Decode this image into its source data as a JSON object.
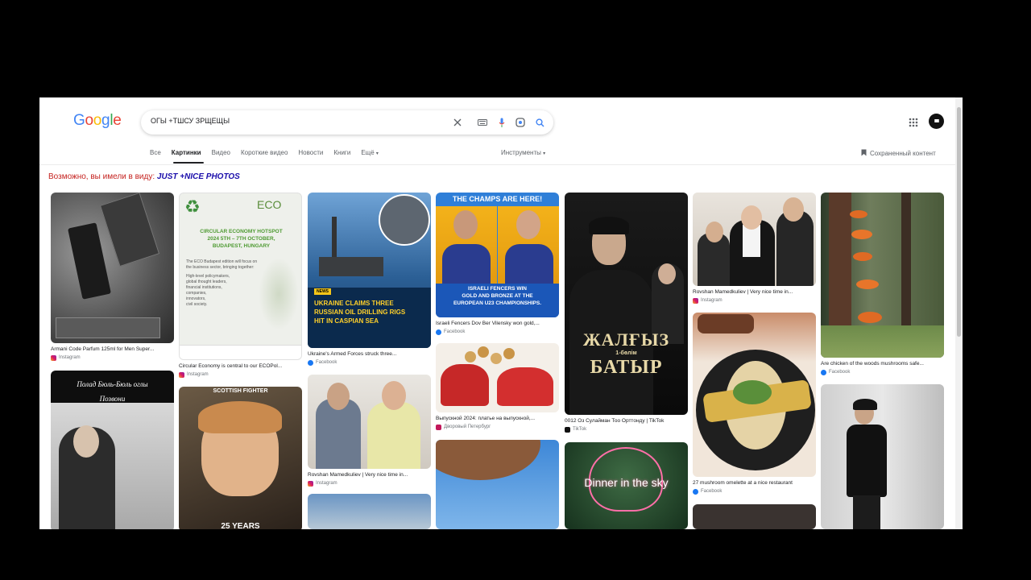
{
  "logo": {
    "g1": "G",
    "o1": "o",
    "o2": "o",
    "g2": "g",
    "l": "l",
    "e": "e"
  },
  "search": {
    "query": "ОГЫ +ТШСУ ЗРЩЕЩЫ"
  },
  "icons": {
    "clear": "close-icon",
    "keyboard": "keyboard-icon",
    "mic": "mic-icon",
    "lens": "lens-icon",
    "search": "search-icon",
    "apps": "apps-grid-icon",
    "saved": "bookmark-icon"
  },
  "tabs": [
    {
      "label": "Все"
    },
    {
      "label": "Картинки",
      "active": true
    },
    {
      "label": "Видео"
    },
    {
      "label": "Короткие видео"
    },
    {
      "label": "Новости"
    },
    {
      "label": "Книги"
    },
    {
      "label": "Ещё"
    }
  ],
  "tools_label": "Инструменты",
  "saved_label": "Сохраненный контент",
  "suggestion": {
    "prefix": "Возможно, вы имели в виду:",
    "term": "JUST +NICE PHOTOS"
  },
  "colors": {
    "accent_link": "#1a0dab",
    "suggest_red": "#c5221f",
    "page_bg": "#000000"
  },
  "results": [
    {
      "caption": "Armani Code Parfum 125ml for Men Super...",
      "source": "Instagram"
    },
    {
      "caption": "",
      "source": "",
      "overlay": [
        "Полад Бюль-Бюль оглы",
        "Позвони"
      ]
    },
    {
      "caption": "Circular Economy is central to our ECOPol...",
      "source": "Instagram",
      "overlay": [
        "ECO",
        "CIRCULAR ECONOMY HOTSPOT",
        "2024 5TH – 7TH OCTOBER,",
        "BUDAPEST, HUNGARY",
        "The ECO Budapest edition will focus on",
        "the business sector, bringing together:",
        "High-level policymakers,",
        "global thought leaders,",
        "financial institutions,",
        "companies,",
        "innovators,",
        "civil society."
      ]
    },
    {
      "caption": "",
      "source": "",
      "overlay": [
        "SCOTTISH FIGHTER",
        "25 YEARS"
      ]
    },
    {
      "caption": "Ukraine's Armed Forces struck three...",
      "source": "Facebook",
      "overlay": [
        "NEWS",
        "UKRAINE CLAIMS THREE",
        "RUSSIAN OIL DRILLING RIGS",
        "HIT IN CASPIAN SEA"
      ]
    },
    {
      "caption": "Rovshan Mamedkuliev | Very nice time in...",
      "source": "Instagram"
    },
    {
      "caption": "Israeli Fencers Dov Ber Vilensky won gold,...",
      "source": "Facebook",
      "overlay": [
        "THE CHAMPS ARE HERE!",
        "ISRAELI FENCERS WIN",
        "GOLD AND BRONZE AT THE",
        "EUROPEAN U23 CHAMPIONSHIPS."
      ]
    },
    {
      "caption": "Выпускной 2024: платье на выпускной,...",
      "source": "Дворовый Петербург"
    },
    {
      "caption": "0012 Оз Сулайман Тоо Орттонду | TikTok",
      "source": "TikTok",
      "overlay": [
        "ЖАЛҒЫЗ",
        "1-бөлім",
        "БАТЫР"
      ]
    },
    {
      "caption": "",
      "source": "",
      "overlay": [
        "Dinner in the sky"
      ]
    },
    {
      "caption": "Rovshan Mamedkuliev | Very nice time in...",
      "source": "Instagram"
    },
    {
      "caption": "27 mushroom omelette at a nice restaurant",
      "source": "Facebook"
    },
    {
      "caption": "Are chicken of the woods mushrooms safe...",
      "source": "Facebook"
    }
  ]
}
